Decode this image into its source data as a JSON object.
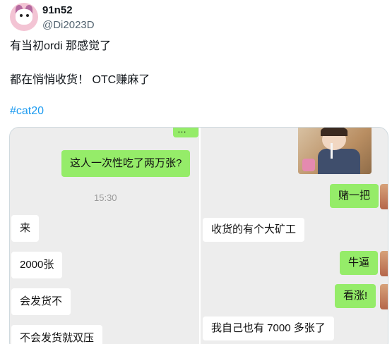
{
  "tweet": {
    "author": {
      "display_name": "91n52",
      "handle": "@Di2023D"
    },
    "lines": [
      "有当初ordi 那感觉了",
      "都在悄悄收货！ OTC赚麻了"
    ],
    "hashtag": "#cat20"
  },
  "media": {
    "left_chat": {
      "messages": [
        {
          "side": "right",
          "text": "…"
        },
        {
          "side": "right",
          "text": "这人一次性吃了两万张?"
        },
        {
          "side": "left",
          "text": "来"
        },
        {
          "side": "left",
          "text": "2000张"
        },
        {
          "side": "left",
          "text": "会发货不"
        },
        {
          "side": "left",
          "text": "不会发货就双压"
        }
      ],
      "timestamp": "15:30"
    },
    "right_chat": {
      "messages": [
        {
          "side": "right",
          "text": "赌一把"
        },
        {
          "side": "left",
          "text": "收货的有个大矿工"
        },
        {
          "side": "right",
          "text": "牛逼"
        },
        {
          "side": "right",
          "text": "看涨!"
        },
        {
          "side": "left",
          "text": "我自己也有 7000 多张了"
        }
      ]
    }
  },
  "colors": {
    "link": "#1d9bf0",
    "chat_green": "#95ec69",
    "chat_background": "#ededed"
  }
}
